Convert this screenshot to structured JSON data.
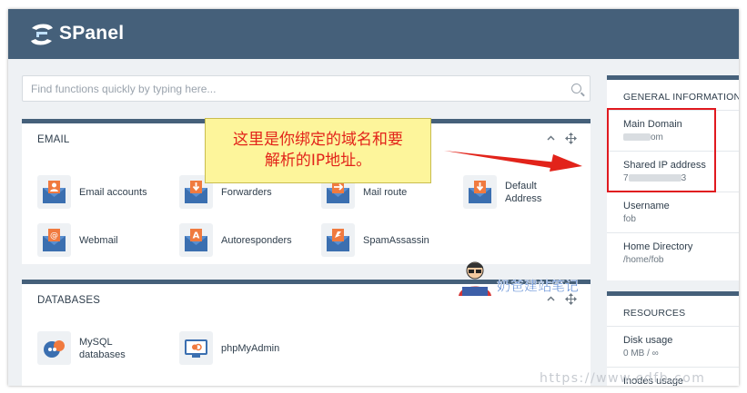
{
  "app": {
    "name": "SPanel"
  },
  "search": {
    "placeholder": "Find functions quickly by typing here..."
  },
  "email": {
    "title": "EMAIL",
    "items": [
      {
        "label": "Email accounts"
      },
      {
        "label": "Forwarders"
      },
      {
        "label": "Mail route"
      },
      {
        "label": "Default Address"
      },
      {
        "label": "Webmail"
      },
      {
        "label": "Autoresponders"
      },
      {
        "label": "SpamAssassin"
      }
    ]
  },
  "databases": {
    "title": "DATABASES",
    "items": [
      {
        "label": "MySQL databases"
      },
      {
        "label": "phpMyAdmin"
      }
    ]
  },
  "general": {
    "title": "GENERAL INFORMATION",
    "main_domain": {
      "label": "Main Domain",
      "value_prefix": "",
      "value_suffix": "om"
    },
    "shared_ip": {
      "label": "Shared IP address",
      "value_prefix": "7",
      "value_suffix": "3"
    },
    "username": {
      "label": "Username",
      "value": "fob"
    },
    "home_directory": {
      "label": "Home Directory",
      "value": "/home/fob"
    }
  },
  "resources": {
    "title": "RESOURCES",
    "disk_usage": {
      "label": "Disk usage",
      "value": "0 MB / ∞"
    },
    "inodes_usage": {
      "label": "Inodes usage"
    }
  },
  "annotation": {
    "line1": "这里是你绑定的域名和要",
    "line2": "解析的IP地址。"
  },
  "watermark": {
    "text": "奶爸建站笔记",
    "url": "https://www.cdfb.com"
  },
  "colors": {
    "header": "#45607a",
    "accent_orange": "#f07a3f",
    "envelope_blue": "#3b6fb0",
    "annotation_red": "#e2231a"
  }
}
